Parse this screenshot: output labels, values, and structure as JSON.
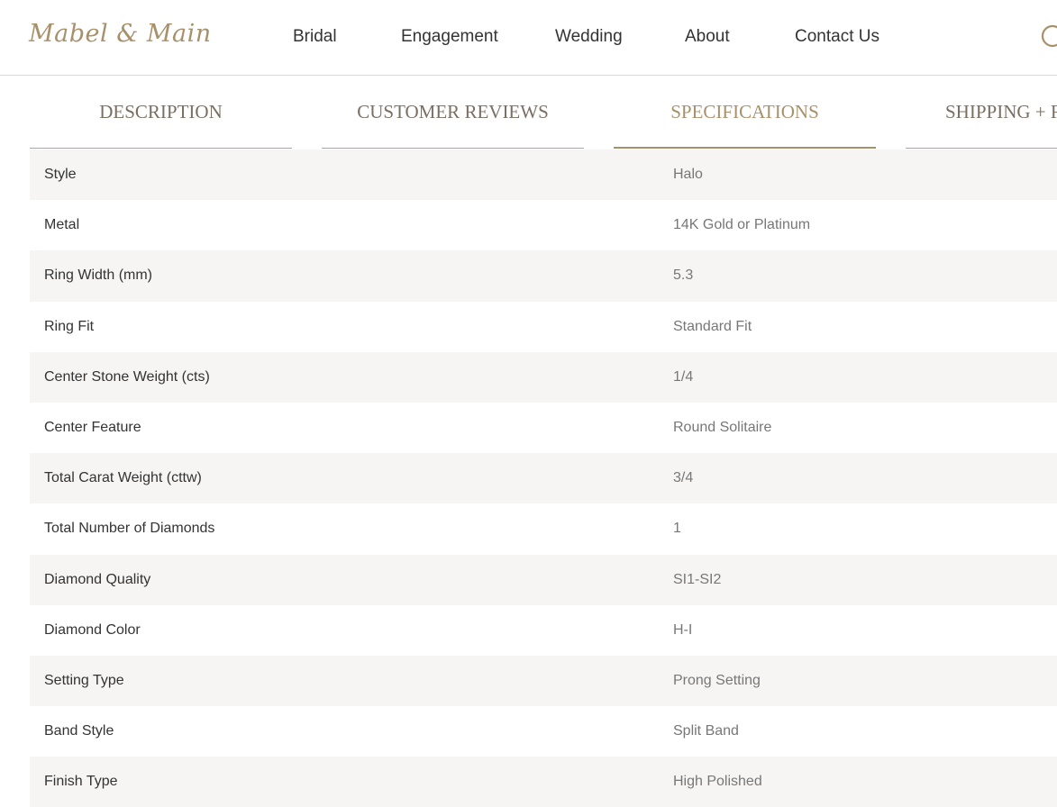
{
  "header": {
    "logo": "Mabel & Main",
    "nav": [
      "Bridal",
      "Engagement",
      "Wedding",
      "About",
      "Contact Us"
    ],
    "search_icon": "search-icon"
  },
  "tabs": [
    {
      "label": "DESCRIPTION",
      "active": false
    },
    {
      "label": "CUSTOMER REVIEWS",
      "active": false
    },
    {
      "label": "SPECIFICATIONS",
      "active": true
    },
    {
      "label": "SHIPPING + R",
      "active": false
    }
  ],
  "specs": [
    {
      "label": "Style",
      "value": "Halo"
    },
    {
      "label": "Metal",
      "value": "14K Gold or Platinum"
    },
    {
      "label": "Ring Width (mm)",
      "value": "5.3"
    },
    {
      "label": "Ring Fit",
      "value": "Standard Fit"
    },
    {
      "label": "Center Stone Weight (cts)",
      "value": "1/4"
    },
    {
      "label": "Center Feature",
      "value": "Round Solitaire"
    },
    {
      "label": "Total Carat Weight (cttw)",
      "value": "3/4"
    },
    {
      "label": "Total Number of Diamonds",
      "value": "1"
    },
    {
      "label": "Diamond Quality",
      "value": "SI1-SI2"
    },
    {
      "label": "Diamond Color",
      "value": "H-I"
    },
    {
      "label": "Setting Type",
      "value": "Prong Setting"
    },
    {
      "label": "Band Style",
      "value": "Split Band"
    },
    {
      "label": "Finish Type",
      "value": "High Polished"
    }
  ],
  "colors": {
    "accent": "#a8906b",
    "row_shade": "#f7f5f3",
    "tab_text": "#7a6f62"
  }
}
